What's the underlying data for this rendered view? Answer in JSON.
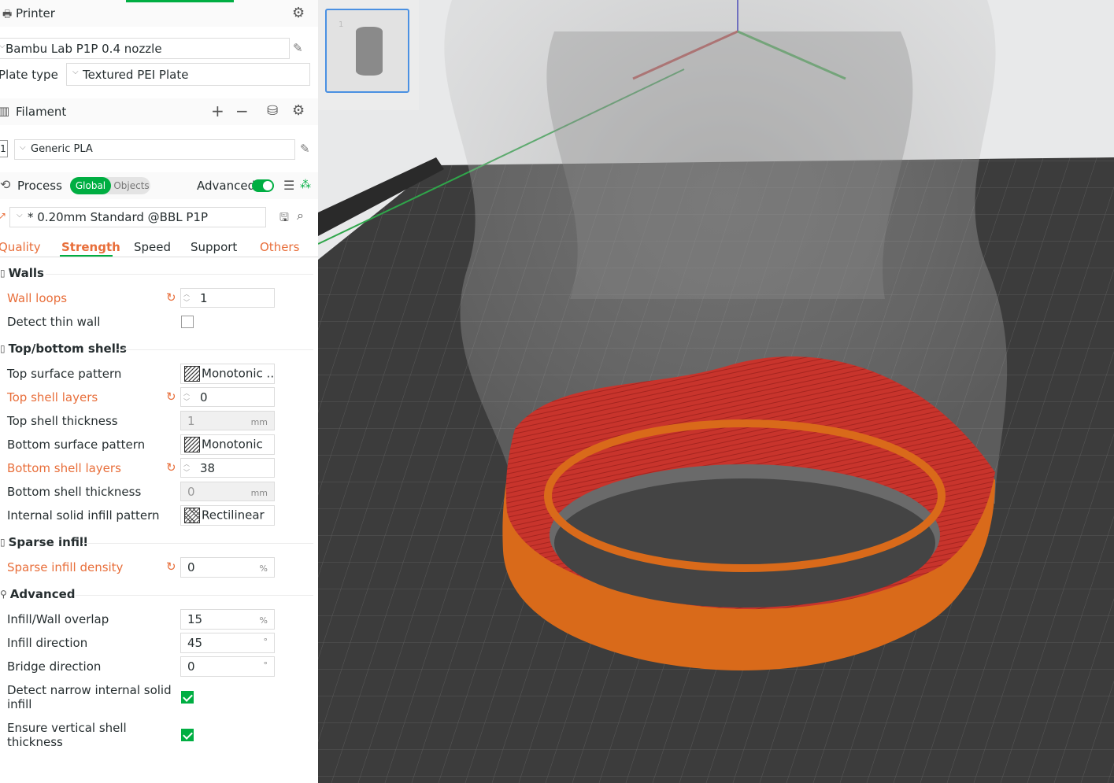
{
  "printer": {
    "section_title": "Printer",
    "preset": "Bambu Lab P1P 0.4 nozzle",
    "plate_type_label": "Plate type",
    "plate_type_value": "Textured PEI Plate"
  },
  "filament": {
    "section_title": "Filament",
    "slot_number": "1",
    "preset": "Generic PLA"
  },
  "process": {
    "section_title": "Process",
    "toggle_global": "Global",
    "toggle_objects": "Objects",
    "advanced_label": "Advanced",
    "advanced_enabled": true,
    "preset": "* 0.20mm Standard @BBL P1P",
    "tabs": [
      "Quality",
      "Strength",
      "Speed",
      "Support",
      "Others"
    ],
    "active_tab": "Strength"
  },
  "walls": {
    "title": "Walls",
    "wall_loops_label": "Wall loops",
    "wall_loops_value": "1",
    "detect_thin_wall_label": "Detect thin wall",
    "detect_thin_wall_checked": false
  },
  "top_bottom": {
    "title": "Top/bottom shells",
    "top_surface_pattern_label": "Top surface pattern",
    "top_surface_pattern_value": "Monotonic ...",
    "top_shell_layers_label": "Top shell layers",
    "top_shell_layers_value": "0",
    "top_shell_thickness_label": "Top shell thickness",
    "top_shell_thickness_value": "1",
    "bottom_surface_pattern_label": "Bottom surface pattern",
    "bottom_surface_pattern_value": "Monotonic",
    "bottom_shell_layers_label": "Bottom shell layers",
    "bottom_shell_layers_value": "38",
    "bottom_shell_thickness_label": "Bottom shell thickness",
    "bottom_shell_thickness_value": "0",
    "internal_solid_infill_pattern_label": "Internal solid infill pattern",
    "internal_solid_infill_pattern_value": "Rectilinear",
    "unit_mm": "mm"
  },
  "sparse": {
    "title": "Sparse infill",
    "density_label": "Sparse infill density",
    "density_value": "0",
    "unit_percent": "%"
  },
  "advanced": {
    "title": "Advanced",
    "overlap_label": "Infill/Wall overlap",
    "overlap_value": "15",
    "overlap_unit": "%",
    "infill_direction_label": "Infill direction",
    "infill_direction_value": "45",
    "bridge_direction_label": "Bridge direction",
    "bridge_direction_value": "0",
    "degree_unit": "°",
    "detect_narrow_label_1": "Detect narrow internal solid",
    "detect_narrow_label_2": "infill",
    "detect_narrow_checked": true,
    "ensure_vertical_label_1": "Ensure vertical shell",
    "ensure_vertical_label_2": "thickness",
    "ensure_vertical_checked": true
  },
  "viewport": {
    "plate_thumbnail_number": "1",
    "model_color": "#d96a1a",
    "top_surface_color": "#c8342c",
    "bed_color": "#3c3c3c",
    "accent_green": "#00ae42",
    "modified_orange": "#e86e3a"
  }
}
